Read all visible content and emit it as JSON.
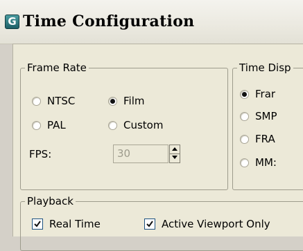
{
  "window": {
    "title": "Time Configuration",
    "icon_letter": "G"
  },
  "frame_rate": {
    "legend": "Frame Rate",
    "options": [
      {
        "label": "NTSC",
        "checked": false
      },
      {
        "label": "Film",
        "checked": true
      },
      {
        "label": "PAL",
        "checked": false
      },
      {
        "label": "Custom",
        "checked": false
      }
    ],
    "fps_label": "FPS:",
    "fps_value": "30"
  },
  "time_display": {
    "legend": "Time Disp",
    "options": [
      {
        "label": "Frar",
        "checked": true
      },
      {
        "label": "SMP",
        "checked": false
      },
      {
        "label": "FRA",
        "checked": false
      },
      {
        "label": "MM:",
        "checked": false
      }
    ]
  },
  "playback": {
    "legend": "Playback",
    "real_time": {
      "label": "Real Time",
      "checked": true
    },
    "active_viewport_only": {
      "label": "Active Viewport Only",
      "checked": true
    }
  }
}
